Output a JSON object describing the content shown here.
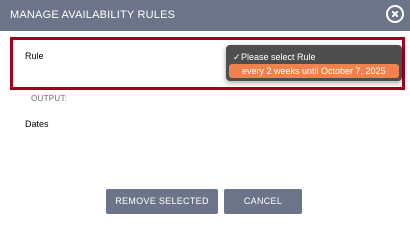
{
  "dialog": {
    "title": "MANAGE AVAILABILITY RULES"
  },
  "form": {
    "rule_label": "Rule",
    "output_label": "OUTPUT:",
    "dates_label": "Dates"
  },
  "dropdown": {
    "check": "✓",
    "selected_option": "Please select Rule",
    "highlighted_option": "every 2 weeks until October 7, 2025"
  },
  "buttons": {
    "remove_selected": "REMOVE SELECTED",
    "cancel": "CANCEL"
  },
  "colors": {
    "header_bg": "#6b7488",
    "frame_border": "#a1001c",
    "dropdown_bg": "#4e4e4e",
    "highlight": "#f0834d"
  },
  "icons": {
    "close": "close-circle-icon",
    "check": "checkmark-icon"
  }
}
